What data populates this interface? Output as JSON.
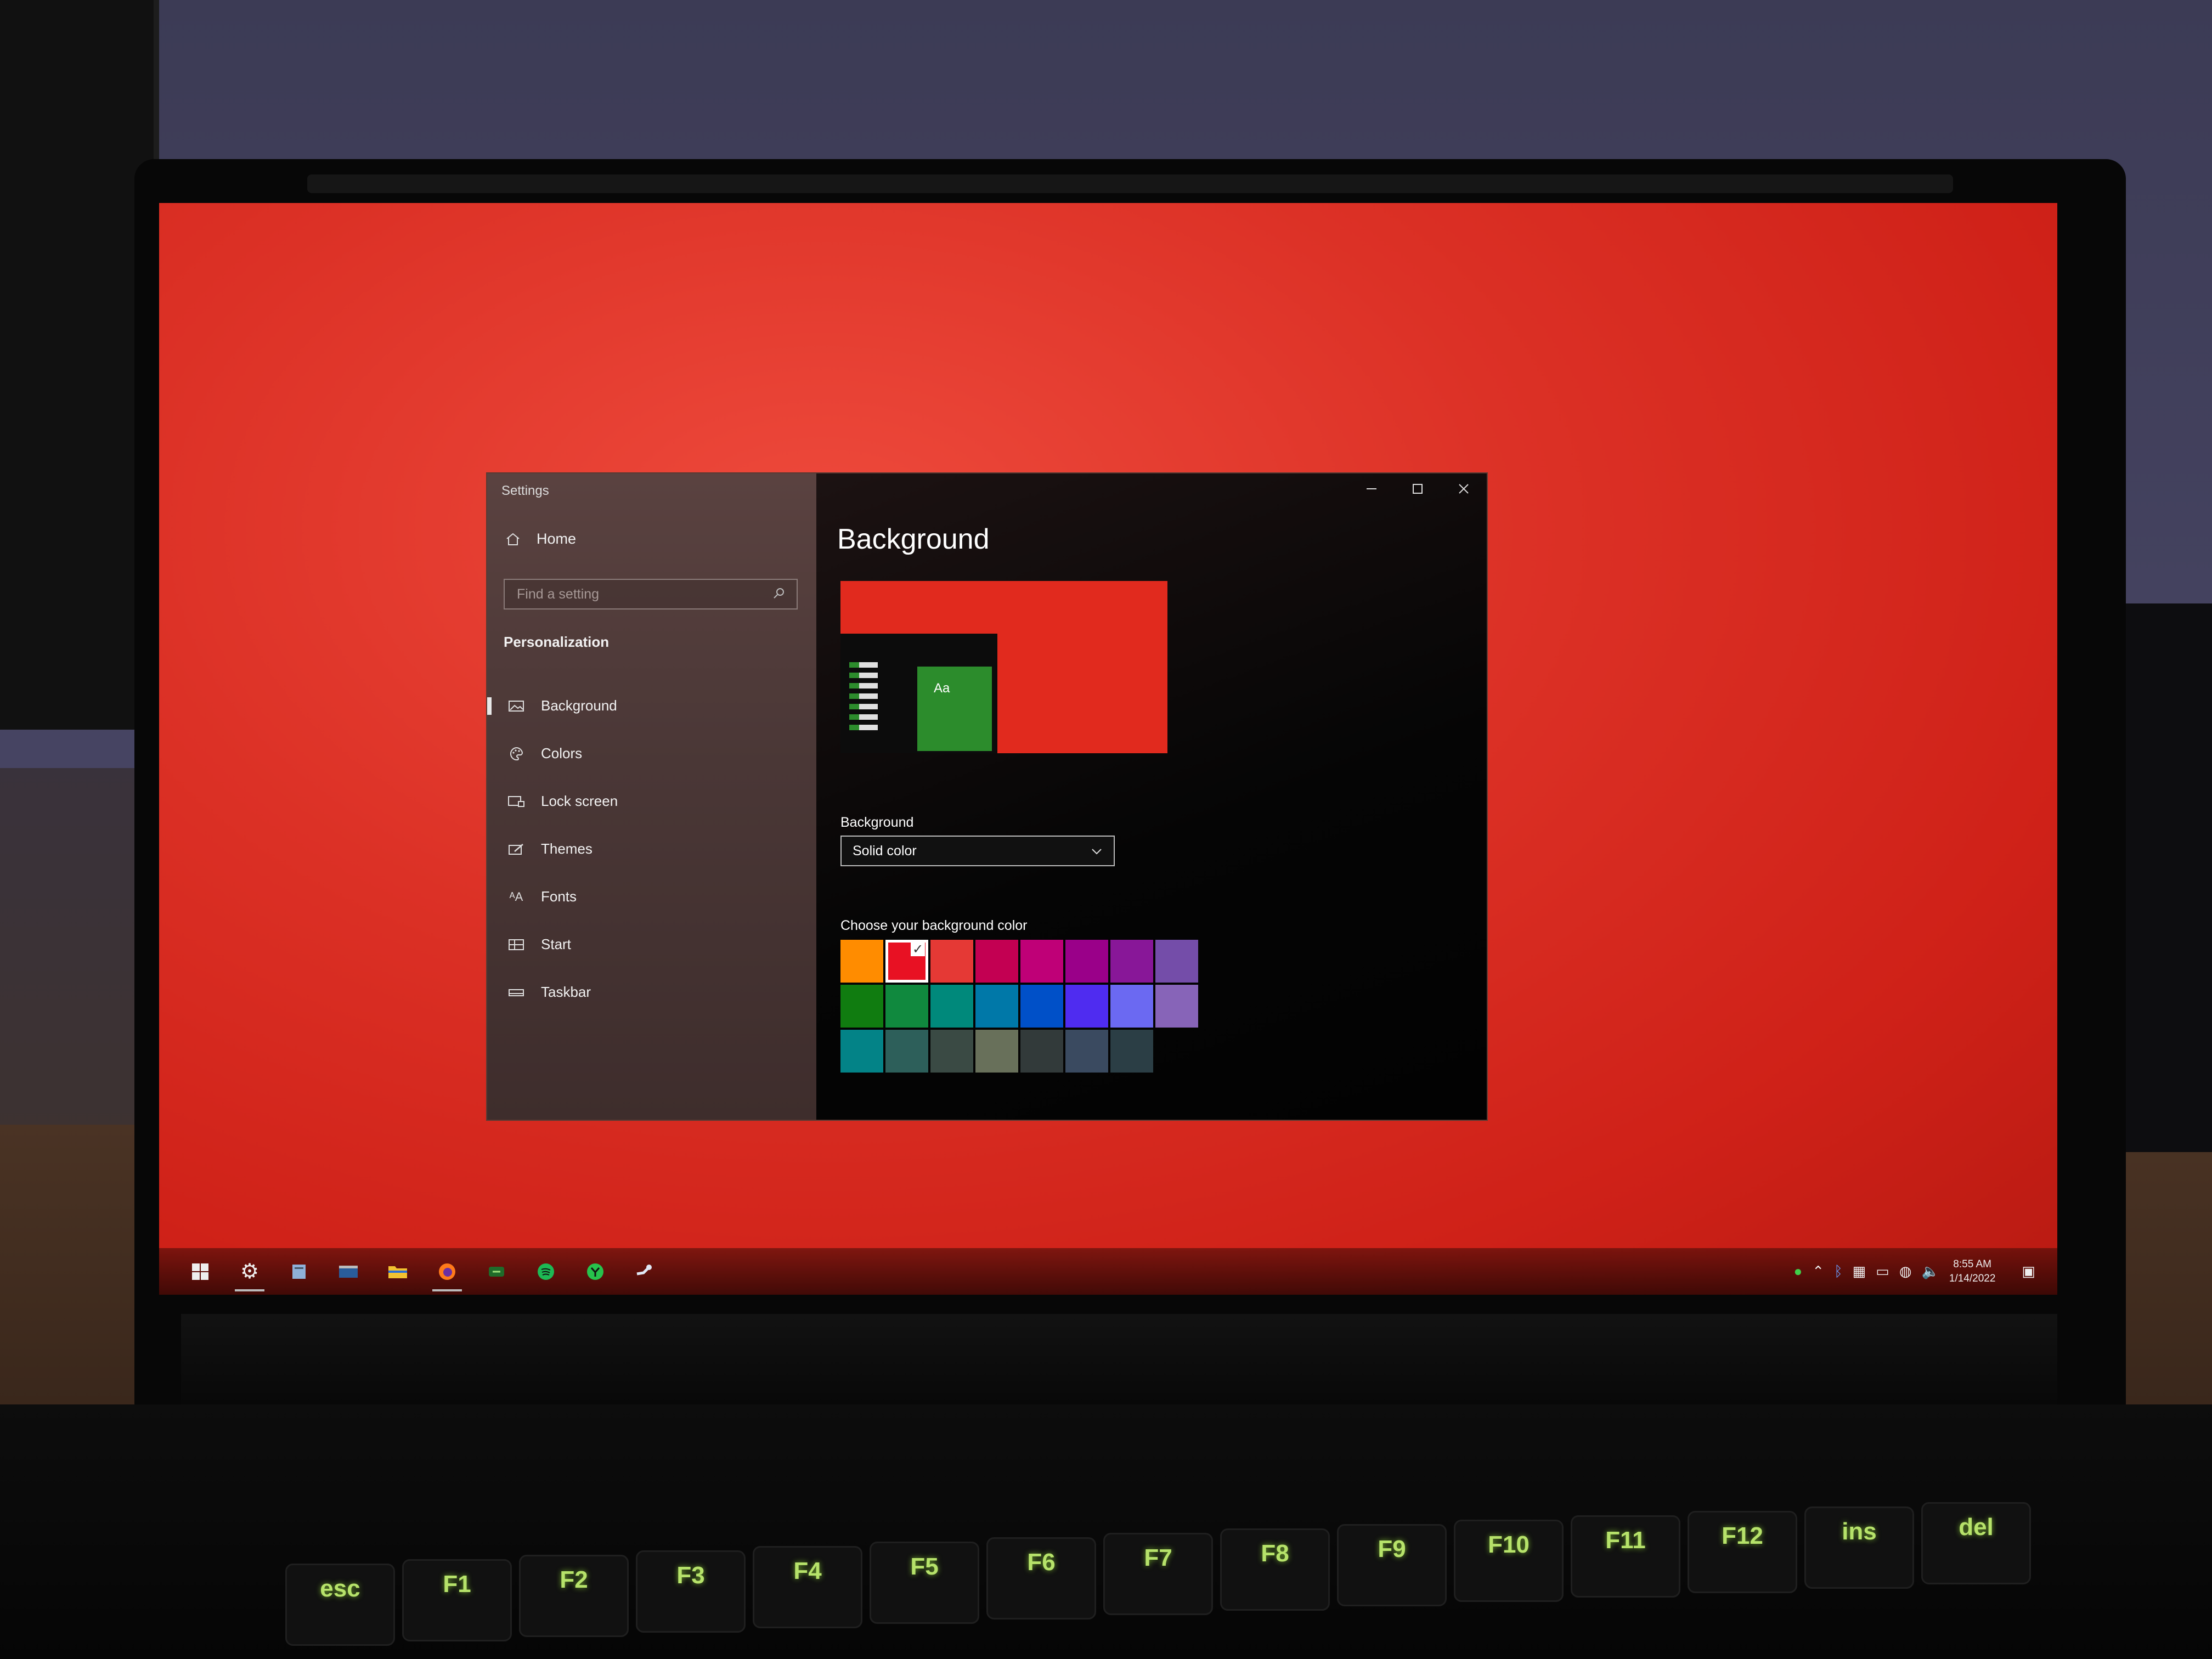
{
  "window": {
    "title": "Settings",
    "controls": [
      "minimize",
      "maximize",
      "close"
    ]
  },
  "sidebar": {
    "home_label": "Home",
    "search_placeholder": "Find a setting",
    "section_title": "Personalization",
    "items": [
      {
        "label": "Background",
        "icon": "picture-icon",
        "active": true
      },
      {
        "label": "Colors",
        "icon": "palette-icon",
        "active": false
      },
      {
        "label": "Lock screen",
        "icon": "lock-screen-icon",
        "active": false
      },
      {
        "label": "Themes",
        "icon": "brush-icon",
        "active": false
      },
      {
        "label": "Fonts",
        "icon": "font-icon",
        "active": false
      },
      {
        "label": "Start",
        "icon": "start-icon",
        "active": false
      },
      {
        "label": "Taskbar",
        "icon": "taskbar-icon",
        "active": false
      }
    ]
  },
  "main": {
    "title": "Background",
    "preview_tile_text": "Aa",
    "background_label": "Background",
    "background_value": "Solid color",
    "color_label": "Choose your background color",
    "selected_color": "#e81123",
    "colors": [
      "#ff8c00",
      "#e81123",
      "#e53935",
      "#c30052",
      "#bf0077",
      "#9a0089",
      "#881798",
      "#744da9",
      "#107c10",
      "#10893e",
      "#00897b",
      "#0078a8",
      "#0050c8",
      "#4f2cf0",
      "#6b69f2",
      "#8764b8",
      "#038387",
      "#2d5f5a",
      "#3a4a44",
      "#68705a",
      "#323a3a",
      "#3a4a60",
      "#2b3e45"
    ]
  },
  "taskbar": {
    "icons": [
      "windows-start-icon",
      "settings-gear-icon",
      "notes-icon",
      "terminal-icon",
      "file-explorer-icon",
      "firefox-icon",
      "xbox-icon",
      "spotify-icon",
      "ctrl-icon",
      "steam-icon"
    ],
    "tray_icons": [
      "shield-icon",
      "chevron-icon",
      "bluetooth-icon",
      "network-icon",
      "battery-icon",
      "globe-icon",
      "volume-icon"
    ],
    "time": "8:55 AM",
    "date": "1/14/2022"
  },
  "keyboard": {
    "keys": [
      "esc",
      "F1",
      "F2",
      "F3",
      "F4",
      "F5",
      "F6",
      "F7",
      "F8",
      "F9",
      "F10",
      "F11",
      "F12",
      "ins",
      "del"
    ]
  }
}
